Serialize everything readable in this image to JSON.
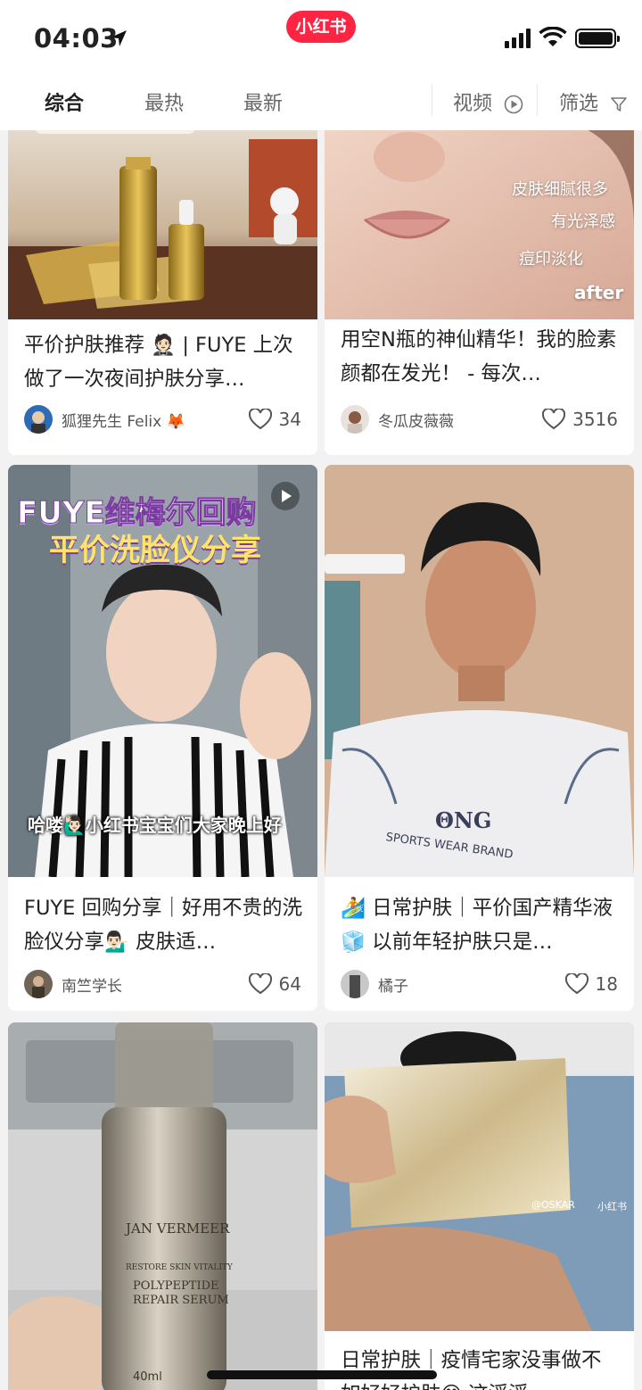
{
  "status_bar": {
    "time": "04:03",
    "app_logo": "小红书"
  },
  "tabs": {
    "items": [
      {
        "label": "综合"
      },
      {
        "label": "最热"
      },
      {
        "label": "最新"
      },
      {
        "label": "视频",
        "icon": "play-circle-icon"
      },
      {
        "label": "筛选",
        "icon": "filter-icon"
      }
    ]
  },
  "notes": [
    {
      "title": "平价护肤推荐 🤵🏻 | FUYE 上次做了一次夜间护肤分享…",
      "author": "狐狸先生 Felix 🦊",
      "likes": "34"
    },
    {
      "title": "用空N瓶的神仙精华！我的脸素颜都在发光！ - 每次…",
      "author": "冬瓜皮薇薇",
      "likes": "3516",
      "image_text": [
        "皮肤细腻很多",
        "有光泽感",
        "痘印淡化",
        "after"
      ]
    },
    {
      "title": "FUYE 回购分享｜好用不贵的洗脸仪分享💁🏻‍♂️ 皮肤适…",
      "author": "南竺学长",
      "likes": "64",
      "image_text": [
        "FUYE维梅尔回购",
        "平价洗脸仪分享",
        "哈喽🙋🏻‍♂️小红书宝宝们大家晚上好"
      ]
    },
    {
      "title": "🏄 日常护肤｜平价国产精华液 🧊 以前年轻护肤只是…",
      "author": "橘子",
      "likes": "18",
      "image_text": [
        "ΘNG",
        "SPORTS WEAR BRAND"
      ]
    },
    {
      "image_text": [
        "JAN VERMEER",
        "RESTORE SKIN VITALITY",
        "POLYPEPTIDE",
        "REPAIR SERUM",
        "40ml"
      ]
    },
    {
      "title": "日常护肤｜疫情宅家没事做不如好好护肤😋 这浮浮…",
      "image_text": [
        "@OSKAR",
        "小红书"
      ]
    }
  ]
}
